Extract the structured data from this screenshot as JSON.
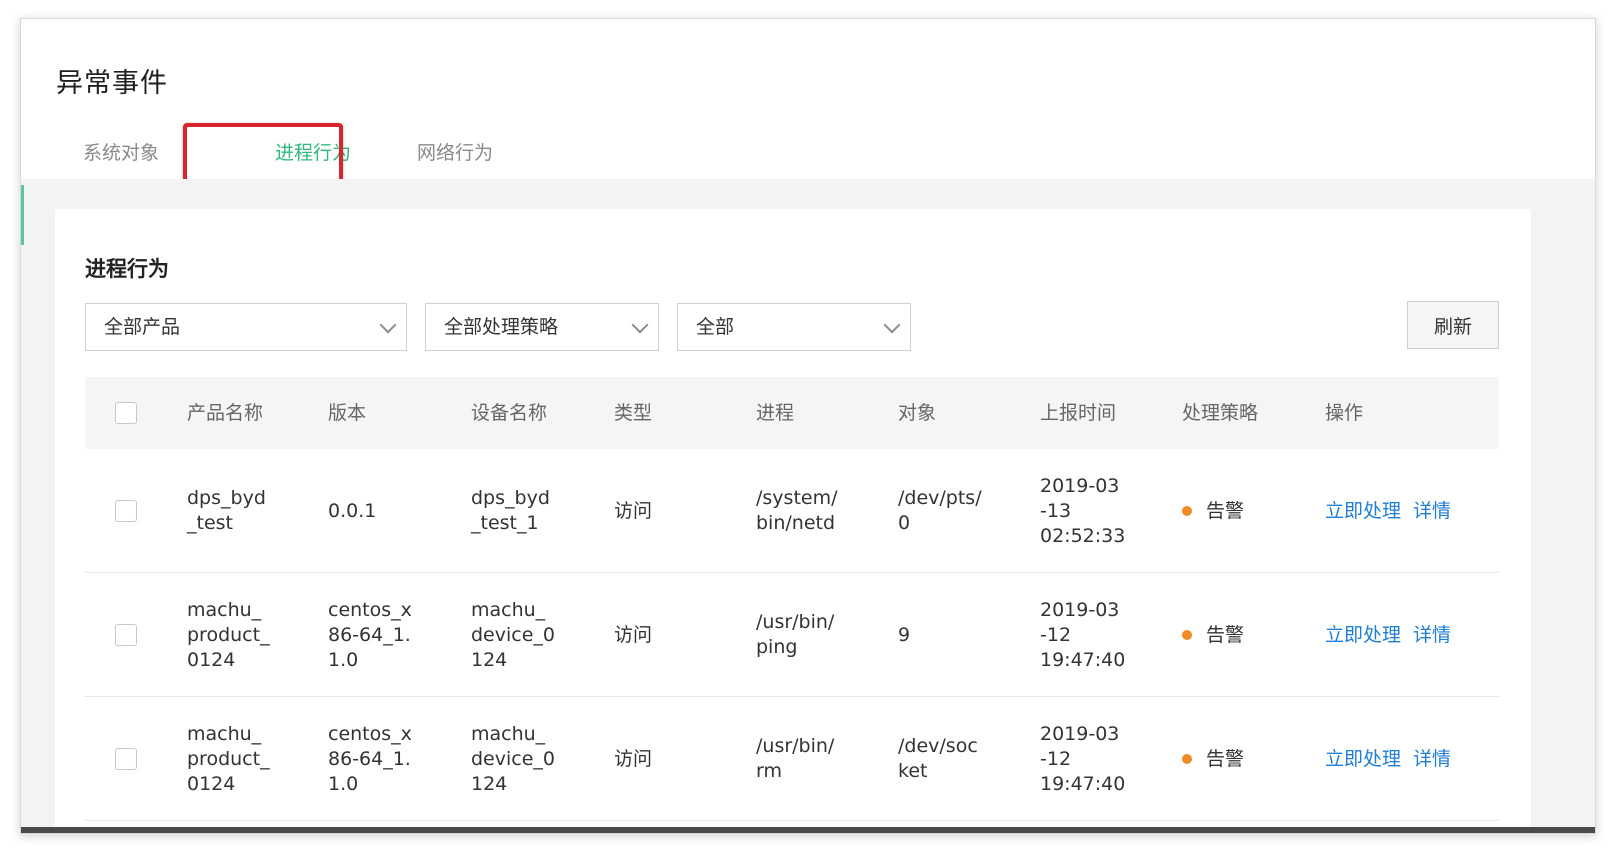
{
  "page": {
    "title": "异常事件"
  },
  "tabs": [
    {
      "label": "系统对象"
    },
    {
      "label": "进程行为"
    },
    {
      "label": "网络行为"
    }
  ],
  "section": {
    "title": "进程行为"
  },
  "filters": {
    "product": "全部产品",
    "policy": "全部处理策略",
    "scope": "全部",
    "refresh_label": "刷新"
  },
  "table": {
    "headers": {
      "product": "产品名称",
      "version": "版本",
      "device": "设备名称",
      "type": "类型",
      "process": "进程",
      "object": "对象",
      "time": "上报时间",
      "policy": "处理策略",
      "actions": "操作"
    },
    "rows": [
      {
        "product": "dps_byd\n_test",
        "version": "0.0.1",
        "device": "dps_byd\n_test_1",
        "type": "访问",
        "process": "/system/\nbin/netd",
        "object": "/dev/pts/\n0",
        "time": "2019-03\n-13\n02:52:33",
        "policy": "告警",
        "action_handle": "立即处理",
        "action_detail": "详情"
      },
      {
        "product": "machu_\nproduct_\n0124",
        "version": "centos_x\n86-64_1.\n1.0",
        "device": "machu_\ndevice_0\n124",
        "type": "访问",
        "process": "/usr/bin/\nping",
        "object": "9",
        "time": "2019-03\n-12\n19:47:40",
        "policy": "告警",
        "action_handle": "立即处理",
        "action_detail": "详情"
      },
      {
        "product": "machu_\nproduct_\n0124",
        "version": "centos_x\n86-64_1.\n1.0",
        "device": "machu_\ndevice_0\n124",
        "type": "访问",
        "process": "/usr/bin/\nrm",
        "object": "/dev/soc\nket",
        "time": "2019-03\n-12\n19:47:40",
        "policy": "告警",
        "action_handle": "立即处理",
        "action_detail": "详情"
      }
    ]
  },
  "colors": {
    "active_tab": "#2fb97c",
    "highlight_box": "#d7262b",
    "alert_dot": "#f08a24",
    "link": "#1f7ed6"
  }
}
